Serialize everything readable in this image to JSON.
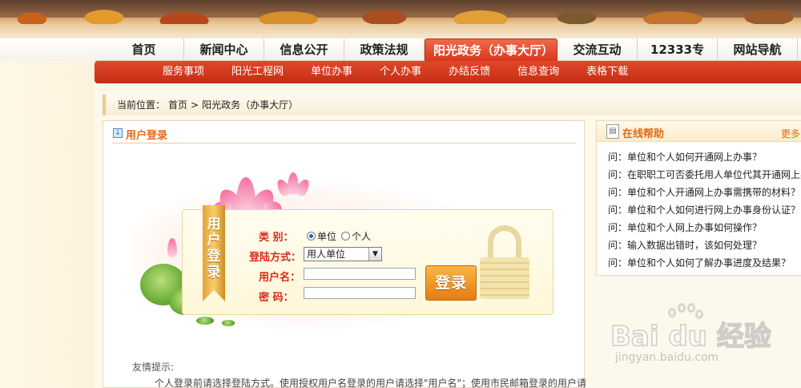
{
  "main_nav": {
    "items": [
      "首页",
      "新闻中心",
      "信息公开",
      "政策法规",
      "阳光政务（办事大厅）",
      "交流互动",
      "12333专栏",
      "网站导航"
    ],
    "active_index": 4
  },
  "sub_nav": {
    "items": [
      "服务事项",
      "阳光工程网",
      "单位办事",
      "个人办事",
      "办结反馈",
      "信息查询",
      "表格下载"
    ]
  },
  "breadcrumb": {
    "prefix": "当前位置：",
    "home": "首页",
    "separator": ">",
    "current": "阳光政务（办事大厅）"
  },
  "login_panel": {
    "title": "用户登录",
    "ribbon_text": "用户登录",
    "type_label": "类   别：",
    "type_options": [
      "单位",
      "个人"
    ],
    "type_selected": "单位",
    "method_label": "登陆方式：",
    "method_value": "用人单位",
    "username_label": "用户名：",
    "username_value": "",
    "password_label": "密   码：",
    "password_value": "",
    "login_button": "登录",
    "tip_title": "友情提示:",
    "tip_text": "个人登录前请选择登陆方式。使用授权用户名登录的用户请选择\"用户名\"；使用市民邮箱登录的用户请"
  },
  "help_panel": {
    "title": "在线帮助",
    "more_label": "更多",
    "items": [
      "问：单位和个人如何开通网上办事？",
      "问：在职职工可否委托用人单位代其开通网上办事",
      "问：单位和个人开通网上办事需携带的材料？",
      "问：单位和个人如何进行网上办事身份认证？",
      "问：单位和个人网上办事如何操作？",
      "问：输入数据出错时，该如何处理？",
      "问：单位和个人如何了解办事进度及结果？"
    ]
  },
  "watermark": {
    "main": "Bai du 经验",
    "sub": "jingyan.baidu.com"
  },
  "colors": {
    "nav_active": "#d9361c",
    "subnav_bg": "#c52d14",
    "accent_orange": "#e06a1a",
    "label_red": "#d82a1a",
    "button_orange": "#e47d12"
  }
}
